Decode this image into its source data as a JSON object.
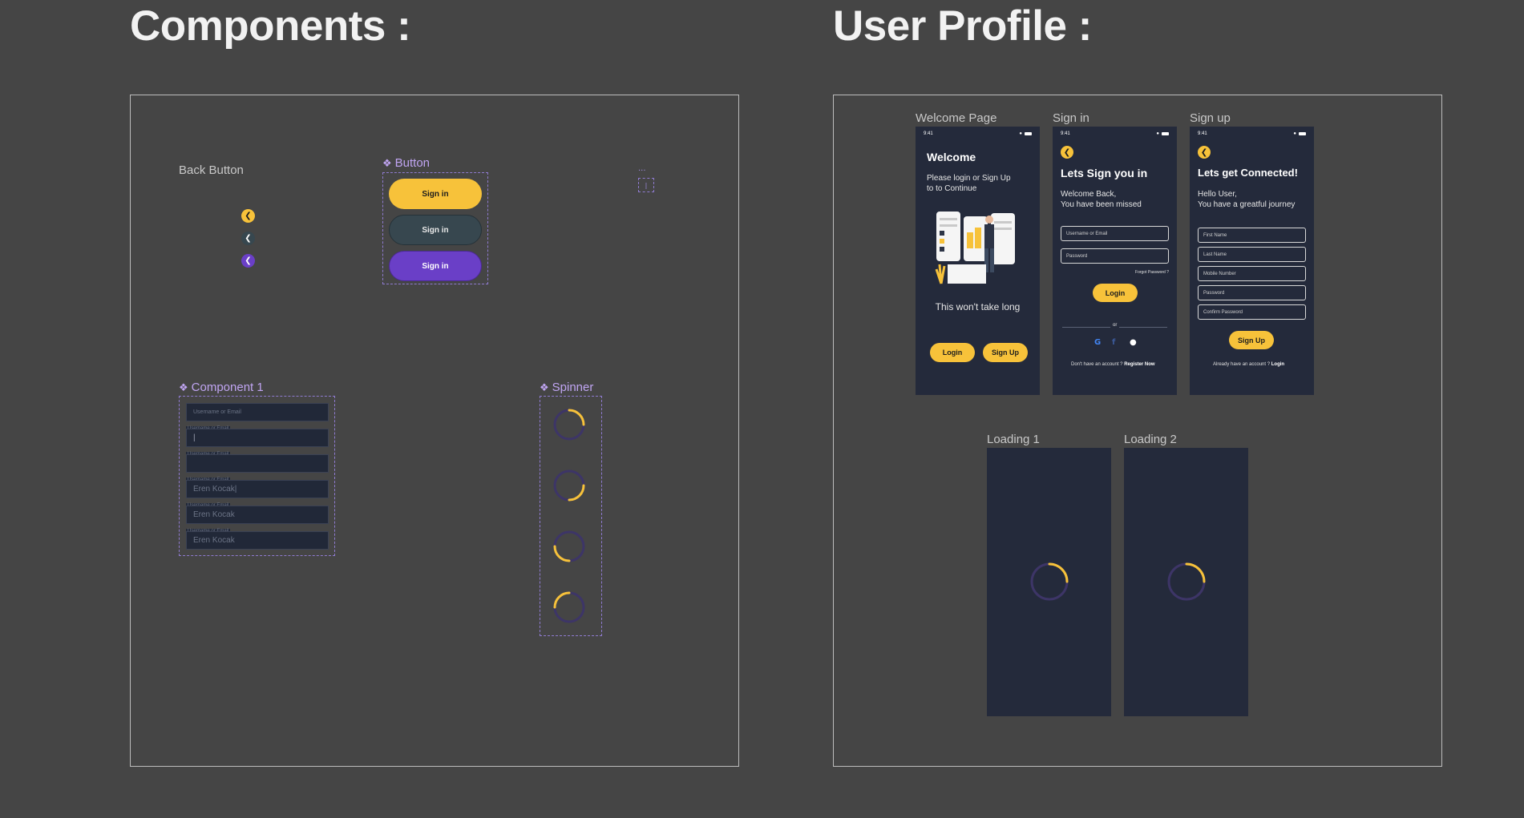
{
  "sections": {
    "components_title": "Components :",
    "user_profile_title": "User Profile :"
  },
  "components": {
    "back_button": {
      "label": "Back Button",
      "icon": "chevron-left-icon",
      "colors": [
        "#f7c23a",
        "#37474f",
        "#6a3fc7"
      ]
    },
    "button": {
      "label": "Button",
      "variants": [
        {
          "label": "Sign in",
          "bg": "#f7c23a",
          "fg": "#1d1d1d"
        },
        {
          "label": "Sign in",
          "bg": "#37474f",
          "fg": "#e8e8e8"
        },
        {
          "label": "Sign in",
          "bg": "#6a3fc7",
          "fg": "#ffffff"
        }
      ]
    },
    "ellipsis": "...",
    "cursor_marker": "|",
    "component_1": {
      "label": "Component 1",
      "fields": [
        {
          "floating": "",
          "value": "Username or Email"
        },
        {
          "floating": "Username or Email",
          "value": "|"
        },
        {
          "floating": "Username or Email",
          "value": ""
        },
        {
          "floating": "Username or Email",
          "value": "Eren Kocak|"
        },
        {
          "floating": "Username or Email",
          "value": "Eren Kocak"
        },
        {
          "floating": "Username or Email",
          "value": "Eren Kocak"
        }
      ]
    },
    "spinner": {
      "label": "Spinner",
      "accent": "#f7c23a",
      "track": "#3d3567"
    }
  },
  "screens": {
    "welcome": {
      "label": "Welcome Page",
      "time": "9:41",
      "title": "Welcome",
      "subtitle_line1": "Please login or Sign Up",
      "subtitle_line2": "to to Continue",
      "tagline": "This won't take long",
      "login_button": "Login",
      "signup_button": "Sign Up"
    },
    "signin": {
      "label": "Sign in",
      "time": "9:41",
      "title": "Lets Sign you in",
      "subtitle_line1": "Welcome Back,",
      "subtitle_line2": "You have been missed",
      "username_placeholder": "Username or Email",
      "password_placeholder": "Password",
      "forgot": "Forgot Password ?",
      "login_button": "Login",
      "or": "or",
      "no_account": "Don't have an account ?",
      "register": "Register Now"
    },
    "signup": {
      "label": "Sign up",
      "time": "9:41",
      "title": "Lets get Connected!",
      "subtitle_line1": "Hello User,",
      "subtitle_line2": "You have a greatful journey",
      "fields": [
        "First Name",
        "Last Name",
        "Mobile Number",
        "Password",
        "Confirm Password"
      ],
      "signup_button": "Sign Up",
      "have_account": "Already have an account ?",
      "login_link": "Login"
    },
    "loading1": {
      "label": "Loading 1"
    },
    "loading2": {
      "label": "Loading 2"
    }
  }
}
